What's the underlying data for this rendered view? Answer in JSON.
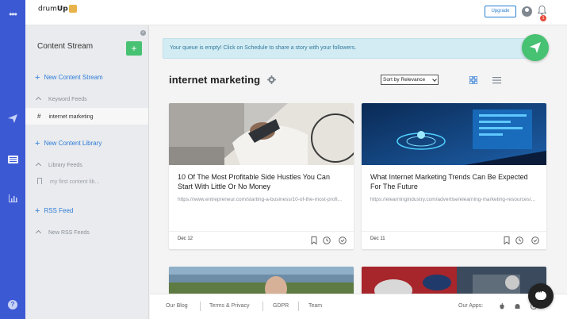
{
  "app": {
    "logo_text": "drum",
    "logo_bold": "Up",
    "upgrade_label": "Upgrade",
    "notification_count": "1"
  },
  "rail": {
    "icons": [
      "more-icon",
      "send-icon",
      "content-icon",
      "analytics-icon",
      "help-icon"
    ]
  },
  "sidebar": {
    "title": "Content Stream",
    "add_label": "+",
    "new_stream": "New Content Stream",
    "keyword_feeds": "Keyword Feeds",
    "keyword_item": "internet marketing",
    "new_library": "New Content Library",
    "library_feeds": "Library Feeds",
    "library_item": "my first content lib...",
    "rss_feed": "RSS Feed",
    "new_rss": "New RSS Feeds"
  },
  "main": {
    "notice": "Your queue is empty! Click on Schedule to share a story with your followers.",
    "topic": "internet marketing",
    "sort_label": "Sort by Relevance",
    "cards": [
      {
        "title": "10 Of The Most Profitable Side Hustles You Can Start With Little Or No Money",
        "url": "https://www.entrepreneur.com/starting-a-business/10-of-the-most-profi...",
        "date": "Dec 12"
      },
      {
        "title": "What Internet Marketing Trends Can Be Expected For The Future",
        "url": "https://elearningindustry.com/advertise/elearning-marketing-resources/...",
        "date": "Dec 11"
      }
    ]
  },
  "footer": {
    "links": [
      "Our Blog",
      "Terms & Privacy",
      "GDPR",
      "Team"
    ],
    "apps_label": "Our Apps:"
  },
  "colors": {
    "rail": "#3c59d4",
    "accent_green": "#47c172",
    "link_blue": "#2f7cd8"
  }
}
